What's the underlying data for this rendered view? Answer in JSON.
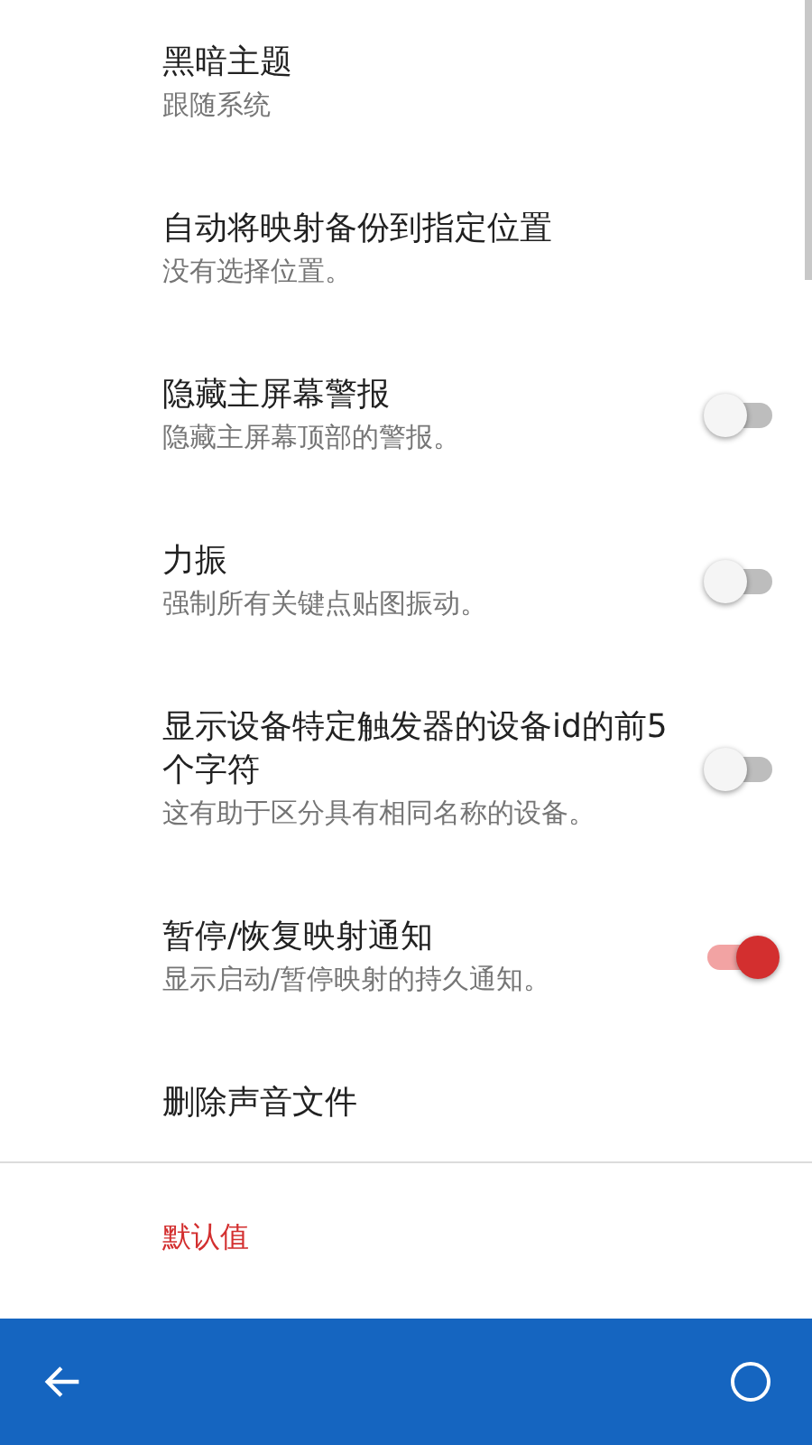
{
  "settings": [
    {
      "kind": "text",
      "title": "黑暗主题",
      "summary": "跟随系统"
    },
    {
      "kind": "text",
      "title": "自动将映射备份到指定位置",
      "summary": "没有选择位置。"
    },
    {
      "kind": "switch",
      "title": "隐藏主屏幕警报",
      "summary": "隐藏主屏幕顶部的警报。",
      "on": false
    },
    {
      "kind": "switch",
      "title": "力振",
      "summary": "强制所有关键点贴图振动。",
      "on": false
    },
    {
      "kind": "switch",
      "title": "显示设备特定触发器的设备id的前5个字符",
      "summary": "这有助于区分具有相同名称的设备。",
      "on": false
    },
    {
      "kind": "switch",
      "title": "暂停/恢复映射通知",
      "summary": "显示启动/暂停映射的持久通知。",
      "on": true
    },
    {
      "kind": "text",
      "title": "删除声音文件"
    }
  ],
  "category": "默认值"
}
